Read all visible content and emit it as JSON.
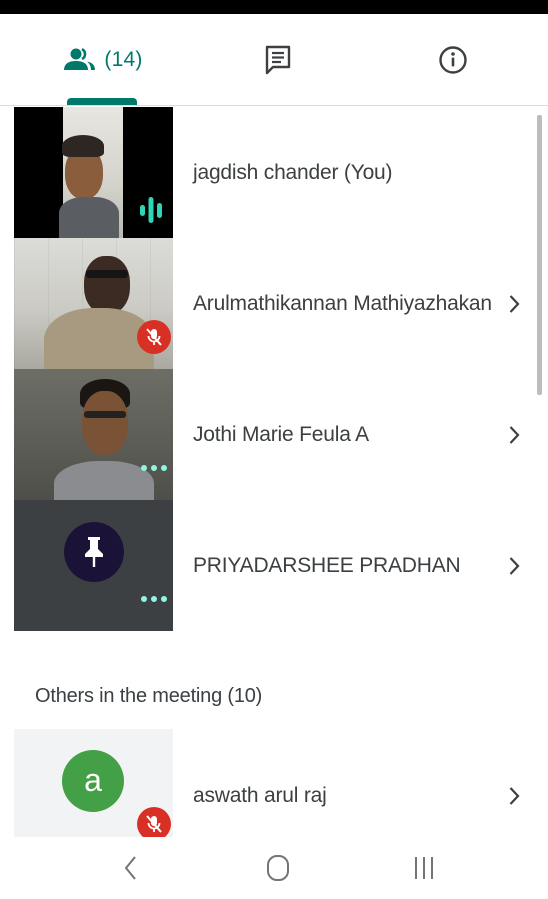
{
  "tabs": {
    "people_count": "(14)",
    "accent_color": "#00796b"
  },
  "participants": [
    {
      "name": "jagdish chander (You)",
      "status": "speaking"
    },
    {
      "name": "Arulmathikannan Mathiyazhakan",
      "status": "muted"
    },
    {
      "name": "Jothi Marie Feula A",
      "status": "more-options"
    },
    {
      "name": "PRIYADARSHEE PRADHAN",
      "status": "pinned"
    }
  ],
  "others": {
    "title": "Others in the meeting (10)",
    "participants": [
      {
        "name": "aswath arul raj",
        "avatar_letter": "a",
        "avatar_color": "#43a047",
        "status": "muted"
      }
    ]
  },
  "icons": {
    "people": "people-icon",
    "chat": "chat-icon",
    "info": "info-icon",
    "chevron": "chevron-right-icon",
    "nav_back": "back-icon",
    "nav_home": "home-icon",
    "nav_recents": "recents-icon"
  }
}
